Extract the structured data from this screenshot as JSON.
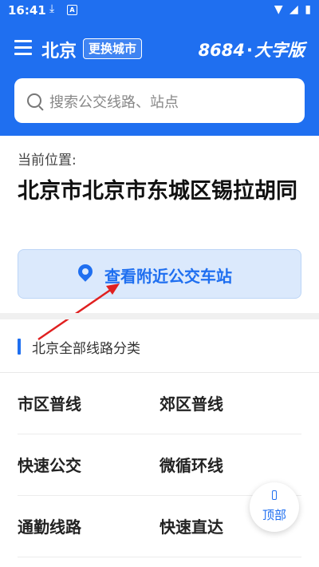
{
  "status_bar": {
    "time": "16:41",
    "download_icon": "download-icon",
    "app_badge": "A"
  },
  "header": {
    "city": "北京",
    "change_city_label": "更换城市",
    "logo_number": "8684",
    "logo_dot": "·",
    "logo_suffix": "大字版",
    "brand_color": "#1f6ff0"
  },
  "search": {
    "placeholder": "搜索公交线路、站点"
  },
  "location": {
    "label": "当前位置:",
    "address": "北京市北京市东城区锡拉胡同"
  },
  "nearby": {
    "label": "查看附近公交车站"
  },
  "routes": {
    "title": "北京全部线路分类",
    "items": [
      "市区普线",
      "郊区普线",
      "快速公交",
      "微循环线",
      "通勤线路",
      "快速直达"
    ]
  },
  "float_button": {
    "label": "顶部"
  }
}
